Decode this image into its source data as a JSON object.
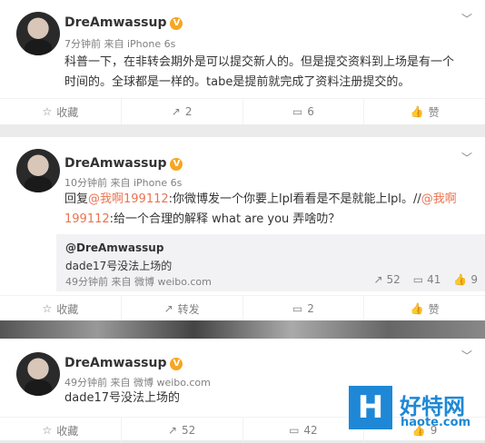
{
  "posts": [
    {
      "name": "DreAmwassup",
      "meta": "7分钟前 来自 iPhone 6s",
      "text": "科普一下，在非转会期外是可以提交新人的。但是提交资料到上场是有一个时间的。全球都是一样的。tabe是提前就完成了资料注册提交的。",
      "actions": {
        "fav": "收藏",
        "repost": "2",
        "comment": "6",
        "like": "赞"
      }
    },
    {
      "name": "DreAmwassup",
      "meta": "10分钟前 来自 iPhone 6s",
      "text_prefix": "回复",
      "mention1": "@我啊199112",
      "text_mid": ":你微博发一个你要上lpl看看是不是就能上lpl。//",
      "mention2": "@我啊199112",
      "text_suffix": ":给一个合理的解释 what are you 弄啥叻？",
      "repost": {
        "name": "@DreAmwassup",
        "text": "dade17号没法上场的",
        "meta": "49分钟前 来自 微博 weibo.com",
        "stats": {
          "repost": "52",
          "comment": "41",
          "like": "9"
        }
      },
      "actions": {
        "fav": "收藏",
        "repost": "转发",
        "comment": "2",
        "like": "赞"
      }
    },
    {
      "name": "DreAmwassup",
      "meta": "49分钟前 来自 微博 weibo.com",
      "text": "dade17号没法上场的",
      "actions": {
        "fav": "收藏",
        "repost": "52",
        "comment": "42",
        "like": "9"
      }
    }
  ],
  "watermark": {
    "logo": "H",
    "title": "好特网",
    "url": "haote.com"
  }
}
